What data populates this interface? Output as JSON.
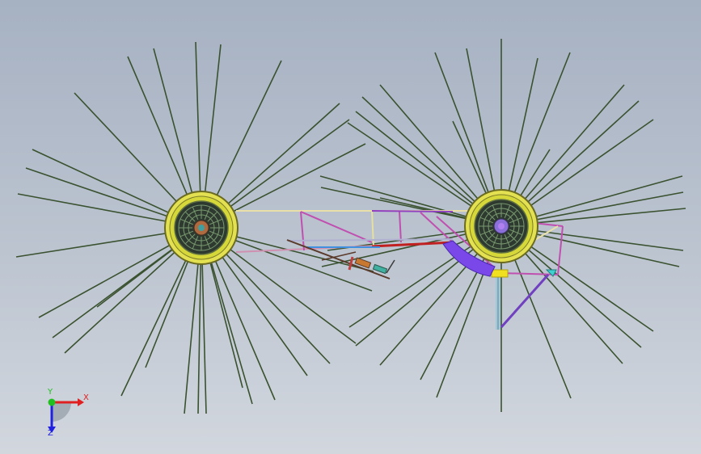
{
  "colors": {
    "background_top": "#a6b1c2",
    "background_bottom": "#d2d7de",
    "spoke": "#3a5230",
    "rim": "#e3e052",
    "axis_x": "#e02020",
    "axis_y": "#20c020",
    "axis_z": "#2020e0"
  },
  "triad": {
    "x_label": "X",
    "y_label": "Y",
    "z_label": "Z"
  }
}
